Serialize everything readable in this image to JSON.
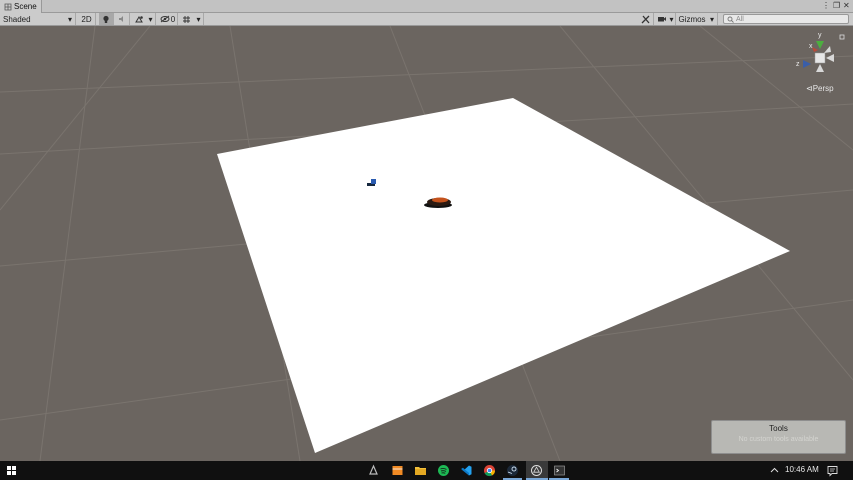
{
  "window": {
    "tab_label": "Scene",
    "controls": {
      "menu": "⋮",
      "restore": "❐",
      "close": "✕"
    }
  },
  "toolbar": {
    "shading_mode": "Shaded",
    "mode_2d": "2D",
    "hidden_count": "0",
    "gizmos_label": "Gizmos",
    "search_placeholder": "All"
  },
  "scene_view": {
    "projection_label": "Persp",
    "gizmo_axes": {
      "x": "x",
      "y": "y",
      "z": "z"
    },
    "colors": {
      "background": "#6b6560",
      "ground_plane": "#ffffff",
      "grid": "#7c7670"
    }
  },
  "tools_overlay": {
    "title": "Tools",
    "subtitle": "No custom tools available"
  },
  "taskbar": {
    "time": "10:46 AM",
    "icons": [
      "windows-start-icon",
      "app-icon",
      "mail-icon",
      "file-explorer-icon",
      "spotify-icon",
      "vscode-icon",
      "chrome-icon",
      "steam-icon",
      "unity-icon",
      "terminal-icon"
    ]
  }
}
